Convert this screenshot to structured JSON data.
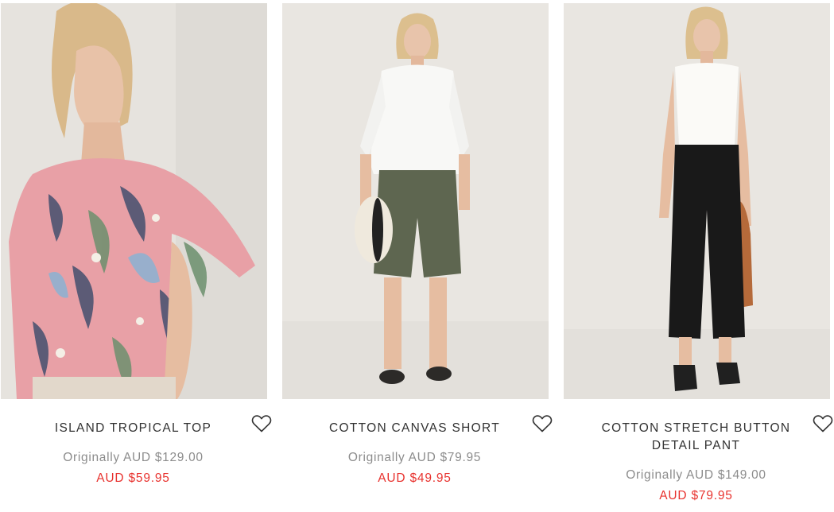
{
  "products": [
    {
      "name": "ISLAND TROPICAL TOP",
      "original_price": "Originally AUD $129.00",
      "sale_price": "AUD $59.95",
      "image_icon": "product-photo",
      "wishlist_icon": "heart-outline-icon"
    },
    {
      "name": "COTTON CANVAS SHORT",
      "original_price": "Originally AUD $79.95",
      "sale_price": "AUD $49.95",
      "image_icon": "product-photo",
      "wishlist_icon": "heart-outline-icon"
    },
    {
      "name": "COTTON STRETCH BUTTON DETAIL PANT",
      "original_price": "Originally AUD $149.00",
      "sale_price": "AUD $79.95",
      "image_icon": "product-photo",
      "wishlist_icon": "heart-outline-icon"
    }
  ],
  "colors": {
    "sale": "#e8322e",
    "original": "#8c8c8c",
    "title": "#333333"
  }
}
